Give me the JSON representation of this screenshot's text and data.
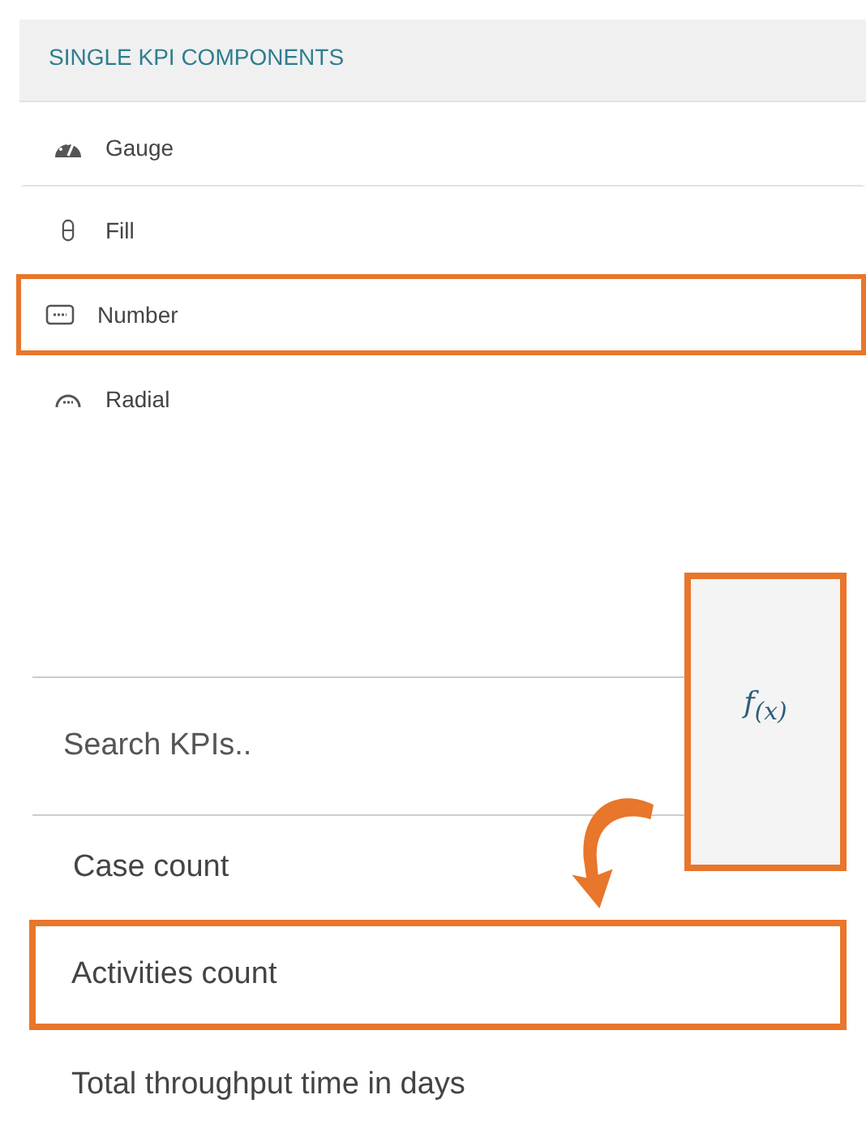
{
  "components_panel": {
    "title": "SINGLE KPI COMPONENTS",
    "items": [
      {
        "kind": "gauge",
        "label": "Gauge",
        "highlighted": false
      },
      {
        "kind": "fill",
        "label": "Fill",
        "highlighted": false
      },
      {
        "kind": "number",
        "label": "Number",
        "highlighted": true
      },
      {
        "kind": "radial",
        "label": "Radial",
        "highlighted": false
      }
    ]
  },
  "kpi_panel": {
    "search": {
      "placeholder": "Search KPIs.."
    },
    "formula_button": {
      "label": "f$_{(x)}$",
      "highlighted": true
    },
    "kpis": [
      {
        "label": "Case count",
        "highlighted": false
      },
      {
        "label": "Activities count",
        "highlighted": true
      },
      {
        "label": "Total throughput time in days",
        "highlighted": false
      }
    ]
  }
}
